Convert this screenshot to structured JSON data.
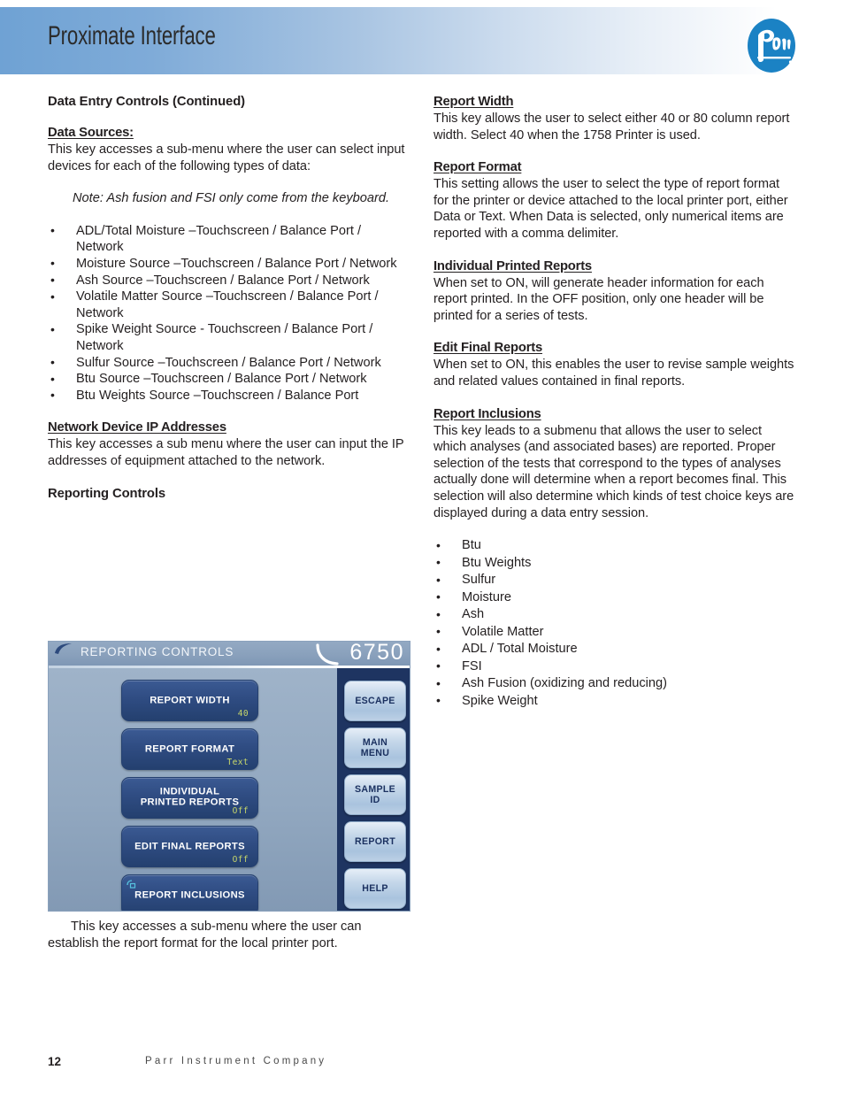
{
  "header": {
    "title": "Proximate Interface",
    "logo_alt": "Parr",
    "gradient_start": "#6fa2d4",
    "gradient_end": "#ffffff",
    "logo_color": "#1b82c4"
  },
  "left_column": {
    "section_title": "Data Entry Controls (Continued)",
    "data_sources": {
      "heading": "Data Sources:",
      "body": "This key accesses a sub-menu where the user can select input devices for each of the following types of data:",
      "note": "Note: Ash fusion and FSI only come from the keyboard.",
      "items": [
        "ADL/Total Moisture –Touchscreen / Balance Port / Network",
        "Moisture Source –Touchscreen / Balance Port / Network",
        "Ash Source –Touchscreen / Balance Port / Network",
        "Volatile Matter Source –Touchscreen / Balance Port / Network",
        "Spike Weight Source - Touchscreen / Balance Port / Network",
        "Sulfur Source  –Touchscreen / Balance Port / Network",
        "Btu Source –Touchscreen / Balance Port / Network",
        "Btu Weights Source –Touchscreen / Balance Port"
      ]
    },
    "network_ip": {
      "heading": "Network Device IP Addresses",
      "body": "This key accesses a sub menu where the user can input the IP addresses of equipment attached to the network."
    },
    "reporting_controls_heading": "Reporting Controls",
    "caption": "This key accesses a sub-menu where the user can establish the report format for the local printer port."
  },
  "device": {
    "title": "REPORTING CONTROLS",
    "model": "6750",
    "value_color": "#c9d86a",
    "sidebar_color": "#1e3461",
    "main_buttons": [
      {
        "label": "REPORT WIDTH",
        "value": "40"
      },
      {
        "label": "REPORT FORMAT",
        "value": "Text"
      },
      {
        "label_line1": "INDIVIDUAL",
        "label_line2": "PRINTED REPORTS",
        "value": "Off"
      },
      {
        "label": "EDIT FINAL REPORTS",
        "value": "Off"
      },
      {
        "label": "REPORT INCLUSIONS",
        "value": ""
      }
    ],
    "side_buttons": [
      {
        "label": "ESCAPE"
      },
      {
        "label_line1": "MAIN",
        "label_line2": "MENU"
      },
      {
        "label_line1": "SAMPLE",
        "label_line2": "ID"
      },
      {
        "label": "REPORT"
      },
      {
        "label": "HELP"
      }
    ]
  },
  "right_column": {
    "report_width": {
      "heading": "Report Width",
      "body": "This key allows the user to select either 40 or 80 column report width.  Select 40 when the 1758 Printer is used."
    },
    "report_format": {
      "heading": "Report Format",
      "body": "This setting allows the user to select the type of report format for the printer or device attached to the local printer port, either Data or Text. When Data is selected, only numerical items are reported with a comma delimiter."
    },
    "individual_printed_reports": {
      "heading": "Individual Printed Reports",
      "body": "When set to ON, will generate header information for each report printed. In the OFF position, only one header will be printed for a series of tests."
    },
    "edit_final_reports": {
      "heading": "Edit Final Reports",
      "body": "When set to ON, this enables the user to revise sample weights and related values contained in final reports."
    },
    "report_inclusions": {
      "heading": "Report Inclusions",
      "body": "This key leads to a submenu that allows the user to select which analyses (and associated bases) are reported.  Proper selection of the tests that correspond to the types of analyses actually done will determine when a report becomes final. This selection will also determine which kinds of test choice keys are displayed during a data entry session.",
      "items": [
        "Btu",
        "Btu Weights",
        "Sulfur",
        "Moisture",
        "Ash",
        "Volatile Matter",
        "ADL / Total Moisture",
        "FSI",
        "Ash Fusion (oxidizing and reducing)",
        "Spike Weight"
      ]
    }
  },
  "footer": {
    "page_number": "12",
    "company": "Parr Instrument Company"
  }
}
